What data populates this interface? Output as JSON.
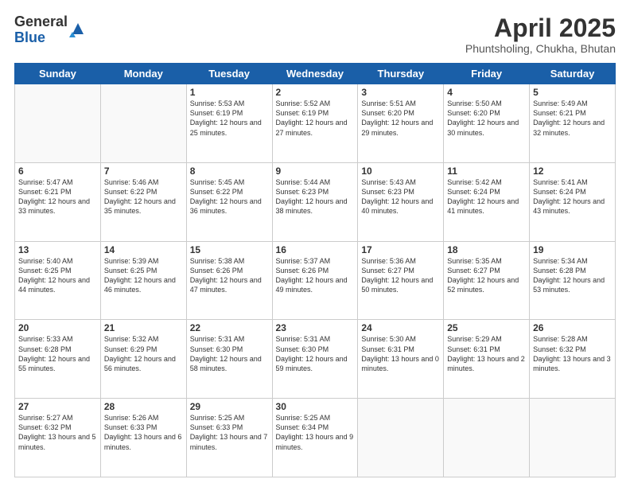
{
  "logo": {
    "general": "General",
    "blue": "Blue"
  },
  "title": "April 2025",
  "subtitle": "Phuntsholing, Chukha, Bhutan",
  "days_of_week": [
    "Sunday",
    "Monday",
    "Tuesday",
    "Wednesday",
    "Thursday",
    "Friday",
    "Saturday"
  ],
  "weeks": [
    [
      {
        "day": "",
        "info": ""
      },
      {
        "day": "",
        "info": ""
      },
      {
        "day": "1",
        "info": "Sunrise: 5:53 AM\nSunset: 6:19 PM\nDaylight: 12 hours and 25 minutes."
      },
      {
        "day": "2",
        "info": "Sunrise: 5:52 AM\nSunset: 6:19 PM\nDaylight: 12 hours and 27 minutes."
      },
      {
        "day": "3",
        "info": "Sunrise: 5:51 AM\nSunset: 6:20 PM\nDaylight: 12 hours and 29 minutes."
      },
      {
        "day": "4",
        "info": "Sunrise: 5:50 AM\nSunset: 6:20 PM\nDaylight: 12 hours and 30 minutes."
      },
      {
        "day": "5",
        "info": "Sunrise: 5:49 AM\nSunset: 6:21 PM\nDaylight: 12 hours and 32 minutes."
      }
    ],
    [
      {
        "day": "6",
        "info": "Sunrise: 5:47 AM\nSunset: 6:21 PM\nDaylight: 12 hours and 33 minutes."
      },
      {
        "day": "7",
        "info": "Sunrise: 5:46 AM\nSunset: 6:22 PM\nDaylight: 12 hours and 35 minutes."
      },
      {
        "day": "8",
        "info": "Sunrise: 5:45 AM\nSunset: 6:22 PM\nDaylight: 12 hours and 36 minutes."
      },
      {
        "day": "9",
        "info": "Sunrise: 5:44 AM\nSunset: 6:23 PM\nDaylight: 12 hours and 38 minutes."
      },
      {
        "day": "10",
        "info": "Sunrise: 5:43 AM\nSunset: 6:23 PM\nDaylight: 12 hours and 40 minutes."
      },
      {
        "day": "11",
        "info": "Sunrise: 5:42 AM\nSunset: 6:24 PM\nDaylight: 12 hours and 41 minutes."
      },
      {
        "day": "12",
        "info": "Sunrise: 5:41 AM\nSunset: 6:24 PM\nDaylight: 12 hours and 43 minutes."
      }
    ],
    [
      {
        "day": "13",
        "info": "Sunrise: 5:40 AM\nSunset: 6:25 PM\nDaylight: 12 hours and 44 minutes."
      },
      {
        "day": "14",
        "info": "Sunrise: 5:39 AM\nSunset: 6:25 PM\nDaylight: 12 hours and 46 minutes."
      },
      {
        "day": "15",
        "info": "Sunrise: 5:38 AM\nSunset: 6:26 PM\nDaylight: 12 hours and 47 minutes."
      },
      {
        "day": "16",
        "info": "Sunrise: 5:37 AM\nSunset: 6:26 PM\nDaylight: 12 hours and 49 minutes."
      },
      {
        "day": "17",
        "info": "Sunrise: 5:36 AM\nSunset: 6:27 PM\nDaylight: 12 hours and 50 minutes."
      },
      {
        "day": "18",
        "info": "Sunrise: 5:35 AM\nSunset: 6:27 PM\nDaylight: 12 hours and 52 minutes."
      },
      {
        "day": "19",
        "info": "Sunrise: 5:34 AM\nSunset: 6:28 PM\nDaylight: 12 hours and 53 minutes."
      }
    ],
    [
      {
        "day": "20",
        "info": "Sunrise: 5:33 AM\nSunset: 6:28 PM\nDaylight: 12 hours and 55 minutes."
      },
      {
        "day": "21",
        "info": "Sunrise: 5:32 AM\nSunset: 6:29 PM\nDaylight: 12 hours and 56 minutes."
      },
      {
        "day": "22",
        "info": "Sunrise: 5:31 AM\nSunset: 6:30 PM\nDaylight: 12 hours and 58 minutes."
      },
      {
        "day": "23",
        "info": "Sunrise: 5:31 AM\nSunset: 6:30 PM\nDaylight: 12 hours and 59 minutes."
      },
      {
        "day": "24",
        "info": "Sunrise: 5:30 AM\nSunset: 6:31 PM\nDaylight: 13 hours and 0 minutes."
      },
      {
        "day": "25",
        "info": "Sunrise: 5:29 AM\nSunset: 6:31 PM\nDaylight: 13 hours and 2 minutes."
      },
      {
        "day": "26",
        "info": "Sunrise: 5:28 AM\nSunset: 6:32 PM\nDaylight: 13 hours and 3 minutes."
      }
    ],
    [
      {
        "day": "27",
        "info": "Sunrise: 5:27 AM\nSunset: 6:32 PM\nDaylight: 13 hours and 5 minutes."
      },
      {
        "day": "28",
        "info": "Sunrise: 5:26 AM\nSunset: 6:33 PM\nDaylight: 13 hours and 6 minutes."
      },
      {
        "day": "29",
        "info": "Sunrise: 5:25 AM\nSunset: 6:33 PM\nDaylight: 13 hours and 7 minutes."
      },
      {
        "day": "30",
        "info": "Sunrise: 5:25 AM\nSunset: 6:34 PM\nDaylight: 13 hours and 9 minutes."
      },
      {
        "day": "",
        "info": ""
      },
      {
        "day": "",
        "info": ""
      },
      {
        "day": "",
        "info": ""
      }
    ]
  ]
}
